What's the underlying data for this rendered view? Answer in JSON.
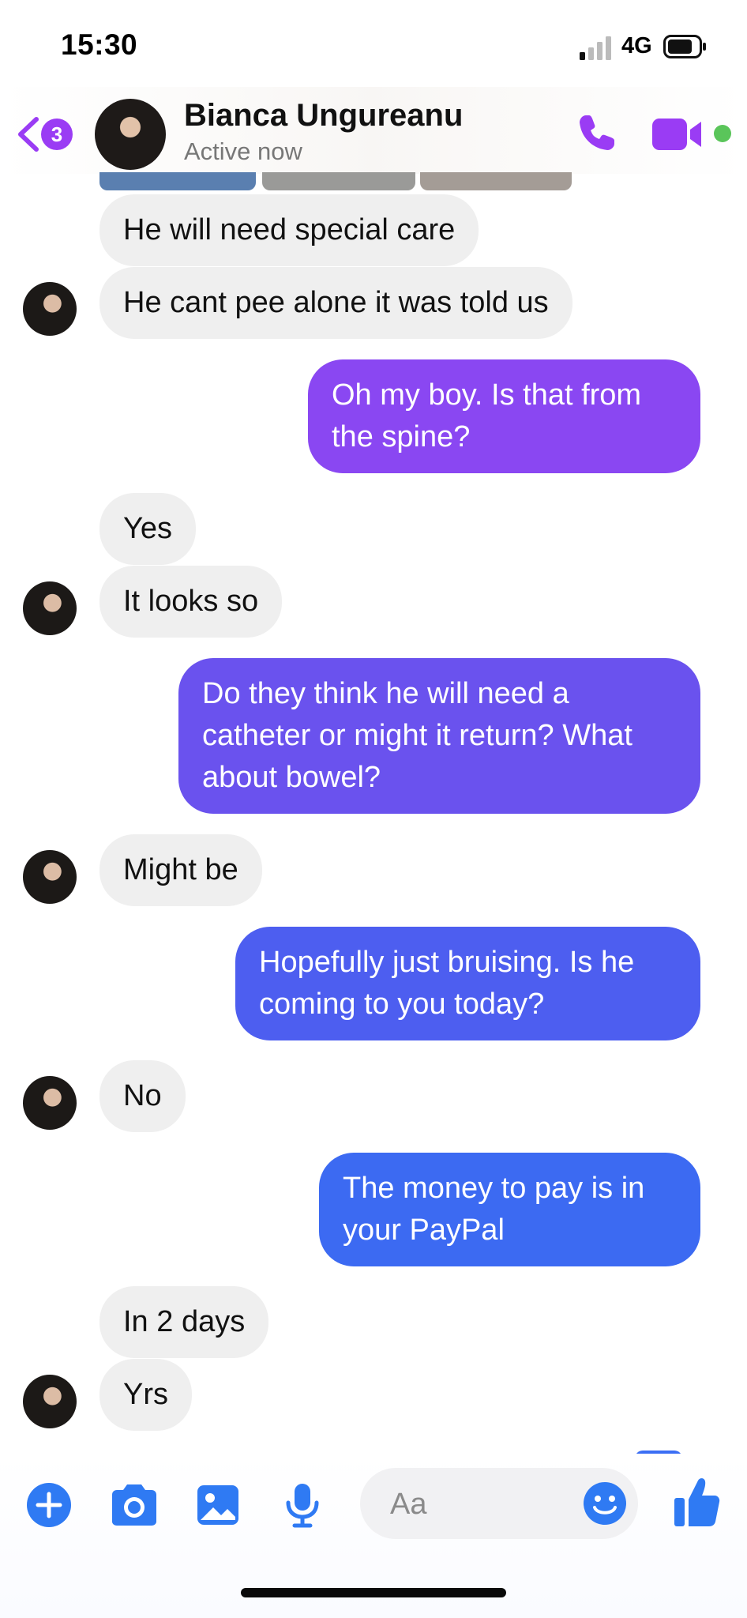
{
  "status_bar": {
    "time": "15:30",
    "network": "4G"
  },
  "header": {
    "back_badge": "3",
    "contact_name": "Bianca Ungureanu",
    "contact_status": "Active now"
  },
  "messages": [
    {
      "direction": "incoming",
      "text": "He will need special care"
    },
    {
      "direction": "incoming",
      "text": "He cant pee alone it was told us"
    },
    {
      "direction": "outgoing",
      "lines": [
        "Oh my boy. Is that from",
        "the spine?"
      ]
    },
    {
      "direction": "incoming",
      "text": "Yes"
    },
    {
      "direction": "incoming",
      "text": "It looks so"
    },
    {
      "direction": "outgoing",
      "lines": [
        "Do they think he will need a",
        "catheter or might it return? What",
        "about bowel?"
      ]
    },
    {
      "direction": "incoming",
      "text": "Might be"
    },
    {
      "direction": "outgoing",
      "lines": [
        "Hopefully just bruising. Is he",
        "coming to you today?"
      ]
    },
    {
      "direction": "incoming",
      "text": "No"
    },
    {
      "direction": "outgoing",
      "lines": [
        "The money to pay is in",
        "your PayPal"
      ]
    },
    {
      "direction": "incoming",
      "text": "In 2 days"
    },
    {
      "direction": "incoming",
      "text": "Yrs"
    }
  ],
  "composer": {
    "placeholder": "Aa"
  },
  "colors": {
    "accent": "#9a3cf4",
    "bubble_in": "#efefef",
    "bubble_out_1": "#8a47f2",
    "bubble_out_2": "#6a52ee",
    "bubble_out_3": "#4d5ef0",
    "bubble_out_4": "#3c6af2",
    "toolbar_blue": "#2f7af3",
    "online": "#5ac55a"
  }
}
